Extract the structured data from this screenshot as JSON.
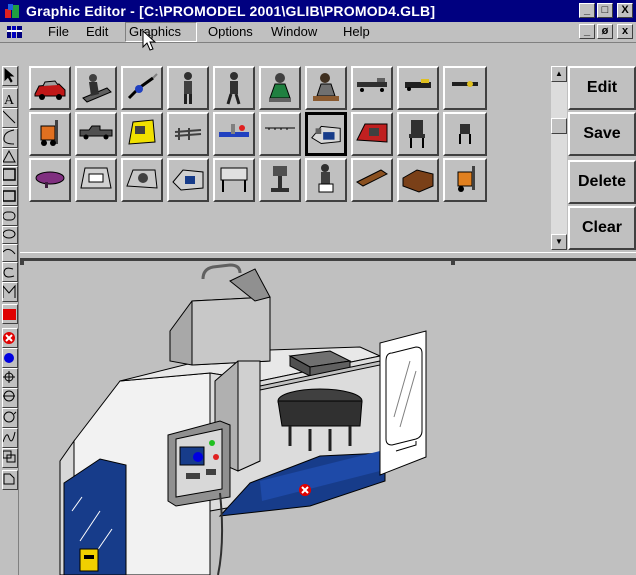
{
  "window": {
    "title": "Graphic Editor - [C:\\PROMODEL 2001\\GLIB\\PROMOD4.GLB]",
    "caption_minimize": "_",
    "caption_restore": "□",
    "caption_close": "X"
  },
  "menu": {
    "items": [
      {
        "label": "File",
        "accel": "F"
      },
      {
        "label": "Edit",
        "accel": "E"
      },
      {
        "label": "Graphics",
        "accel": "G",
        "active": true
      },
      {
        "label": "Options",
        "accel": "O"
      },
      {
        "label": "Window",
        "accel": "W"
      },
      {
        "label": "Help",
        "accel": "H"
      }
    ],
    "doc_minimize": "_",
    "doc_restore": "ø",
    "doc_close": "x"
  },
  "toolbar": {
    "tools": [
      "pointer",
      "text",
      "line",
      "arc",
      "triangle",
      "rectangle",
      "filled-rectangle",
      "rounded-rectangle",
      "ellipse",
      "curve",
      "spiral",
      "polygon",
      "fill-color",
      "delete-point",
      "point",
      "rotate",
      "step",
      "circle",
      "freehand",
      "group",
      "import"
    ]
  },
  "library": {
    "rows": [
      [
        "car",
        "conveyor-operator",
        "welding-robot",
        "worker-standing",
        "worker-walking",
        "seated-worker-green",
        "seated-worker-desk",
        "flatbed-cart",
        "pallet-jack"
      ],
      [
        "forklift",
        "pickup-truck",
        "yellow-press",
        "rack",
        "blue-assembly",
        "rail",
        "cnc-machine",
        "red-machine",
        "chair"
      ],
      [
        "purple-table",
        "lathe",
        "turning-center",
        "milling-center",
        "workbench",
        "drill-press",
        "seated-operator",
        "wooden-table",
        "desk"
      ]
    ],
    "selected_row": 1,
    "selected_col": 6,
    "last_item": "forklift-orange"
  },
  "actions": {
    "edit": "Edit",
    "save": "Save",
    "delete": "Delete",
    "clear": "Clear"
  },
  "colors": {
    "titlebar": "#000080",
    "face": "#c0c0c0",
    "machine_blue": "#173c8a"
  }
}
